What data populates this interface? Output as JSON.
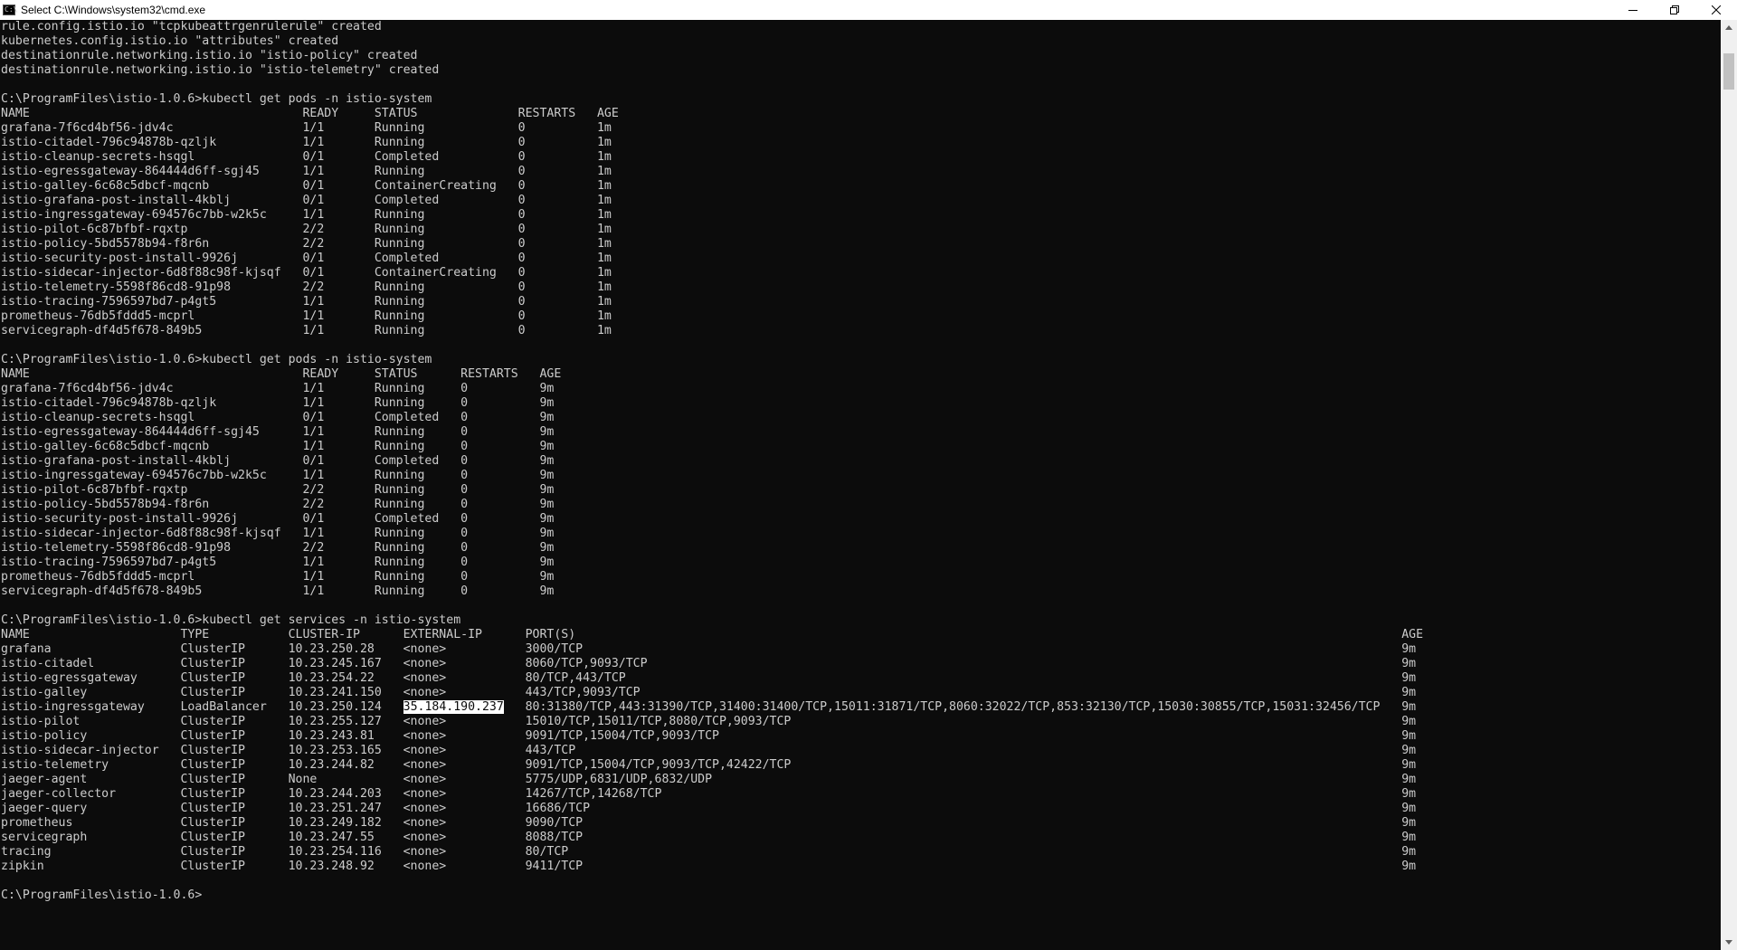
{
  "window": {
    "title": "Select C:\\Windows\\system32\\cmd.exe",
    "icon_text": "C:\\",
    "icon": "cmd-icon",
    "controls": [
      "minimize-icon",
      "maximize-icon",
      "close-icon"
    ]
  },
  "console": {
    "fg_color": "#cccccc",
    "bg_color": "#0c0c0c",
    "lines": [
      "rule.config.istio.io \"tcpkubeattrgenrulerule\" created",
      "kubernetes.config.istio.io \"attributes\" created",
      "destinationrule.networking.istio.io \"istio-policy\" created",
      "destinationrule.networking.istio.io \"istio-telemetry\" created",
      "",
      "C:\\ProgramFiles\\istio-1.0.6>kubectl get pods -n istio-system",
      "NAME                                      READY     STATUS              RESTARTS   AGE",
      "grafana-7f6cd4bf56-jdv4c                  1/1       Running             0          1m",
      "istio-citadel-796c94878b-qzljk            1/1       Running             0          1m",
      "istio-cleanup-secrets-hsqgl               0/1       Completed           0          1m",
      "istio-egressgateway-864444d6ff-sgj45      1/1       Running             0          1m",
      "istio-galley-6c68c5dbcf-mqcnb             0/1       ContainerCreating   0          1m",
      "istio-grafana-post-install-4kblj          0/1       Completed           0          1m",
      "istio-ingressgateway-694576c7bb-w2k5c     1/1       Running             0          1m",
      "istio-pilot-6c87bfbf-rqxtp                2/2       Running             0          1m",
      "istio-policy-5bd5578b94-f8r6n             2/2       Running             0          1m",
      "istio-security-post-install-9926j         0/1       Completed           0          1m",
      "istio-sidecar-injector-6d8f88c98f-kjsqf   0/1       ContainerCreating   0          1m",
      "istio-telemetry-5598f86cd8-91p98          2/2       Running             0          1m",
      "istio-tracing-7596597bd7-p4gt5            1/1       Running             0          1m",
      "prometheus-76db5fddd5-mcprl               1/1       Running             0          1m",
      "servicegraph-df4d5f678-849b5              1/1       Running             0          1m",
      "",
      "C:\\ProgramFiles\\istio-1.0.6>kubectl get pods -n istio-system",
      "NAME                                      READY     STATUS      RESTARTS   AGE",
      "grafana-7f6cd4bf56-jdv4c                  1/1       Running     0          9m",
      "istio-citadel-796c94878b-qzljk            1/1       Running     0          9m",
      "istio-cleanup-secrets-hsqgl               0/1       Completed   0          9m",
      "istio-egressgateway-864444d6ff-sgj45      1/1       Running     0          9m",
      "istio-galley-6c68c5dbcf-mqcnb             1/1       Running     0          9m",
      "istio-grafana-post-install-4kblj          0/1       Completed   0          9m",
      "istio-ingressgateway-694576c7bb-w2k5c     1/1       Running     0          9m",
      "istio-pilot-6c87bfbf-rqxtp                2/2       Running     0          9m",
      "istio-policy-5bd5578b94-f8r6n             2/2       Running     0          9m",
      "istio-security-post-install-9926j         0/1       Completed   0          9m",
      "istio-sidecar-injector-6d8f88c98f-kjsqf   1/1       Running     0          9m",
      "istio-telemetry-5598f86cd8-91p98          2/2       Running     0          9m",
      "istio-tracing-7596597bd7-p4gt5            1/1       Running     0          9m",
      "prometheus-76db5fddd5-mcprl               1/1       Running     0          9m",
      "servicegraph-df4d5f678-849b5              1/1       Running     0          9m",
      "",
      "C:\\ProgramFiles\\istio-1.0.6>kubectl get services -n istio-system",
      "NAME                     TYPE           CLUSTER-IP      EXTERNAL-IP      PORT(S)                                                                                                                   AGE",
      "grafana                  ClusterIP      10.23.250.28    <none>           3000/TCP                                                                                                                  9m",
      "istio-citadel            ClusterIP      10.23.245.167   <none>           8060/TCP,9093/TCP                                                                                                         9m",
      "istio-egressgateway      ClusterIP      10.23.254.22    <none>           80/TCP,443/TCP                                                                                                            9m",
      "istio-galley             ClusterIP      10.23.241.150   <none>           443/TCP,9093/TCP                                                                                                          9m",
      {
        "pre": "istio-ingressgateway     LoadBalancer   10.23.250.124   ",
        "hl": "35.184.190.237",
        "post": "   80:31380/TCP,443:31390/TCP,31400:31400/TCP,15011:31871/TCP,8060:32022/TCP,853:32130/TCP,15030:30855/TCP,15031:32456/TCP   9m"
      },
      "istio-pilot              ClusterIP      10.23.255.127   <none>           15010/TCP,15011/TCP,8080/TCP,9093/TCP                                                                                     9m",
      "istio-policy             ClusterIP      10.23.243.81    <none>           9091/TCP,15004/TCP,9093/TCP                                                                                               9m",
      "istio-sidecar-injector   ClusterIP      10.23.253.165   <none>           443/TCP                                                                                                                   9m",
      "istio-telemetry          ClusterIP      10.23.244.82    <none>           9091/TCP,15004/TCP,9093/TCP,42422/TCP                                                                                     9m",
      "jaeger-agent             ClusterIP      None            <none>           5775/UDP,6831/UDP,6832/UDP                                                                                                9m",
      "jaeger-collector         ClusterIP      10.23.244.203   <none>           14267/TCP,14268/TCP                                                                                                       9m",
      "jaeger-query             ClusterIP      10.23.251.247   <none>           16686/TCP                                                                                                                 9m",
      "prometheus               ClusterIP      10.23.249.182   <none>           9090/TCP                                                                                                                  9m",
      "servicegraph             ClusterIP      10.23.247.55    <none>           8088/TCP                                                                                                                  9m",
      "tracing                  ClusterIP      10.23.254.116   <none>           80/TCP                                                                                                                    9m",
      "zipkin                   ClusterIP      10.23.248.92    <none>           9411/TCP                                                                                                                  9m",
      "",
      "C:\\ProgramFiles\\istio-1.0.6>"
    ]
  },
  "scrollbar": {
    "icons": [
      "scroll-up-arrow-icon",
      "scroll-down-arrow-icon"
    ],
    "bg_color": "#f0f0f0",
    "thumb_color": "#c1c1c1"
  }
}
